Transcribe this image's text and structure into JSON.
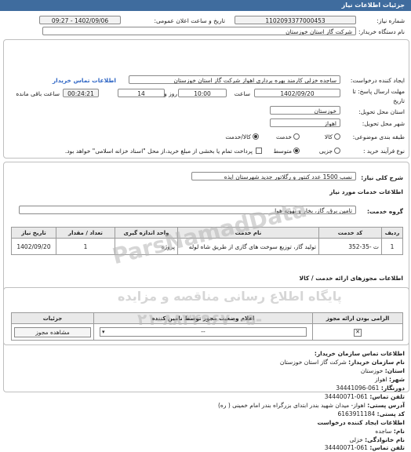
{
  "header": {
    "title": "جزئیات اطلاعات نیاز"
  },
  "form": {
    "need_number_label": "شماره نیاز:",
    "need_number": "1102093377000453",
    "announce_label": "تاریخ و ساعت اعلان عمومی:",
    "announce_value": "1402/09/06 - 09:27",
    "buyer_label": "نام دستگاه خریدار:",
    "buyer_value": "شرکت گاز استان خوزستان",
    "creator_label": "ایجاد کننده درخواست:",
    "creator_value": "ساجده خزلی کارمند بهره برداری اهواز شرکت گاز استان خوزستان",
    "contact_link": "اطلاعات تماس خریدار",
    "deadline_label": "مهلت ارسال پاسخ: تا",
    "deadline_label2": "تاریخ",
    "deadline_date": "1402/09/20",
    "time_label": "ساعت",
    "deadline_time": "10:00",
    "days_value": "14",
    "days_label": "روز و",
    "remaining_time": "00:24:21",
    "remaining_label": "ساعت باقی مانده",
    "province_label": "استان محل تحویل:",
    "province_value": "خوزستان",
    "city_label": "شهر محل تحویل:",
    "city_value": "اهواز",
    "category_label": "طبقه بندی موضوعی:",
    "category_options": [
      "کالا",
      "خدمت",
      "کالا/خدمت"
    ],
    "process_label": "نوع فرآیند خرید :",
    "process_options": [
      "جزیی",
      "متوسط"
    ],
    "payment_note": "پرداخت تمام یا بخشی از مبلغ خرید،از محل \"اسناد خزانه اسلامی\" خواهد بود."
  },
  "summary": {
    "label": "شرح کلی نیاز:",
    "value": "نصب 1500 عدد کنتور و رگلاتور جدید شهرستان ایذه"
  },
  "services": {
    "title": "اطلاعات خدمات مورد نیاز",
    "group_label": "گروه خدمت:",
    "group_value": "تامین برق، گاز، بخار و تهویه هوا",
    "columns": [
      "ردیف",
      "کد خدمت",
      "نام خدمت",
      "واحد اندازه گیری",
      "تعداد / مقدار",
      "تاریخ نیاز"
    ],
    "rows": [
      {
        "row": "1",
        "code": "ت -35-352",
        "name": "تولید گاز، توزیع سوخت های گازی از طریق شاه لوله",
        "unit": "پروژه",
        "qty": "1",
        "date": "1402/09/20"
      }
    ]
  },
  "permits": {
    "title": "اطلاعات مجوزهای ارائه خدمت / کالا",
    "columns": [
      "الزامی بودن ارائه مجوز",
      "اعلام وضعیت مجوز توسط نامین کننده",
      "جزئیات"
    ],
    "row": {
      "status": "--",
      "button": "مشاهده مجوز"
    }
  },
  "contact": {
    "title": "اطلاعات تماس سازمان خریدار:",
    "lines": [
      {
        "k": "نام سازمان خریدار:",
        "v": "شرکت گاز استان خوزستان"
      },
      {
        "k": "استان:",
        "v": "خوزستان"
      },
      {
        "k": "شهر:",
        "v": "اهواز"
      },
      {
        "k": "دورنگار:",
        "v": "061-34441096"
      },
      {
        "k": "تلفن تماس:",
        "v": "061-34440071"
      },
      {
        "k": "آدرس پستی:",
        "v": "اهواز- میدان شهید بندر ابتدای بزرگراه بندر امام خمینی ( ره)"
      },
      {
        "k": "کد پستی:",
        "v": "6163911184"
      },
      {
        "k": "اطلاعات ایجاد کننده درخواست",
        "v": ""
      },
      {
        "k": "نام:",
        "v": "ساجده"
      },
      {
        "k": "نام خانوادگی:",
        "v": "خزلی"
      },
      {
        "k": "تلفن تماس:",
        "v": "061-34440071"
      }
    ]
  },
  "watermark": {
    "line1": "ParsNamadData",
    "line2": "پایگاه اطلاع رسانی مناقصه و مزایده",
    "line3": "-۲۱-۸۸۳۴۹۶۷۰-۵"
  }
}
